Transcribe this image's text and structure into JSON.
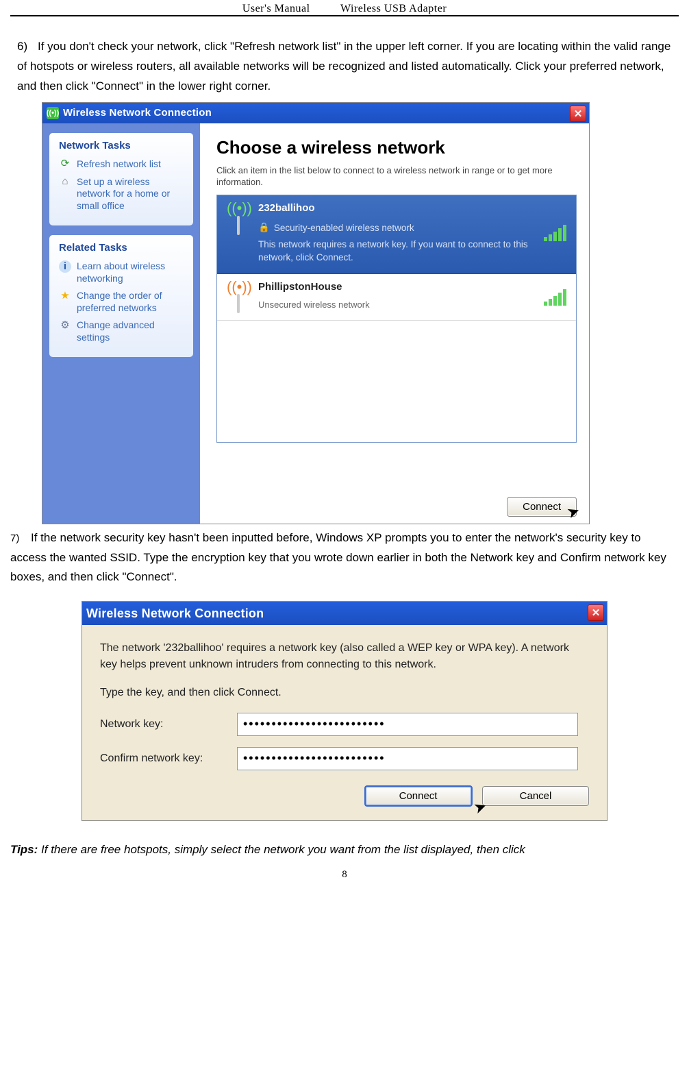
{
  "header": {
    "left": "User's Manual",
    "right": "Wireless USB Adapter"
  },
  "step6": {
    "num": "6)",
    "text": "If you don't check your network, click \"Refresh network list\" in the upper left corner. If you are locating within the valid range of hotspots or wireless routers, all available networks will be recognized and listed automatically. Click your preferred network, and then click \"Connect\" in the lower right corner."
  },
  "dialog1": {
    "title": "Wireless Network Connection",
    "left": {
      "box1_title": "Network Tasks",
      "refresh": "Refresh network list",
      "setup": "Set up a wireless network for a home or small office",
      "box2_title": "Related Tasks",
      "learn": "Learn about wireless networking",
      "order": "Change the order of preferred networks",
      "advanced": "Change advanced settings"
    },
    "right": {
      "heading": "Choose a wireless network",
      "sub": "Click an item in the list below to connect to a wireless network in range or to get more information.",
      "net1": {
        "name": "232ballihoo",
        "security": "Security-enabled wireless network",
        "desc": "This network requires a network key. If you want to connect to this network, click Connect."
      },
      "net2": {
        "name": "PhillipstonHouse",
        "security": "Unsecured wireless network"
      },
      "connect_btn": "Connect"
    }
  },
  "step7": {
    "num": "7)",
    "text": "If the network security key hasn't been inputted before, Windows XP prompts you to enter the network's security key to access the wanted SSID. Type the encryption key that you wrote down earlier in both the Network key and Confirm network key boxes, and then click \"Connect\"."
  },
  "dialog2": {
    "title": "Wireless Network Connection",
    "p1": "The network '232ballihoo' requires a network key (also called a WEP key or WPA key). A network key helps prevent unknown intruders from connecting to this network.",
    "p2": "Type the key, and then click Connect.",
    "label_key": "Network key:",
    "label_confirm": "Confirm network key:",
    "masked": "•••••••••••••••••••••••••",
    "connect": "Connect",
    "cancel": "Cancel"
  },
  "tips": {
    "label": "Tips:",
    "text": " If there are free hotspots, simply select the network you want from the list displayed, then click"
  },
  "page_number": "8"
}
